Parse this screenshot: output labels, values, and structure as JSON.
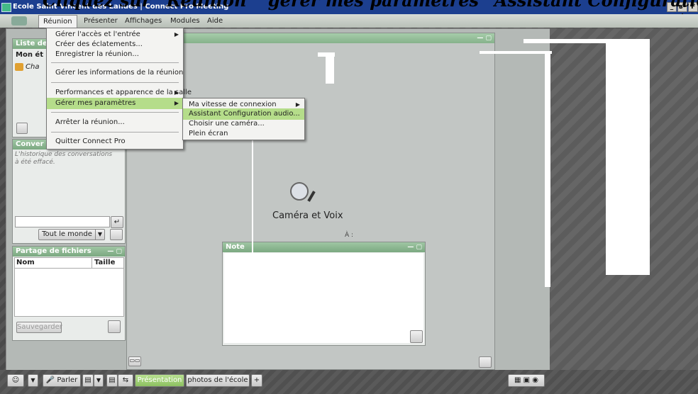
{
  "window": {
    "title": "Ecole Saint Vincent des Landes | Connect Pro Meeting",
    "controls": [
      "_",
      "в–¡",
      "Г—"
    ]
  },
  "caption": "Cliquez sur “Réunion” ‘gérer mes paramètres’ ‘Assistant Configuration",
  "menubar": {
    "items": [
      "Réunion",
      "Présenter",
      "Affichages",
      "Modules",
      "Aide"
    ]
  },
  "reunion_menu": {
    "items": [
      "Gérer l'accès et l'entrée",
      "Créer des éclatements...",
      "Enregistrer la réunion...",
      "Gérer les informations de la réunion",
      "Performances et apparence de la salle",
      "Gérer mes paramètres",
      "Arrêter la réunion...",
      "Quitter Connect Pro"
    ]
  },
  "parametres_menu": {
    "items": [
      "Ma vitesse de connexion",
      "Assistant Configuration audio...",
      "Choisir une caméra...",
      "Plein écran"
    ]
  },
  "attendees": {
    "title": "Liste de",
    "row_label": "Mon ét",
    "user": "Cha"
  },
  "chat": {
    "title": "Conver",
    "history_text": "L'historique des conversations à été effacé.",
    "recipient": "Tout le monde"
  },
  "files": {
    "title": "Partage de fichiers",
    "col_name": "Nom",
    "col_size": "Taille",
    "save_label": "Sauvegarder"
  },
  "camera": {
    "label": "Caméra et Voix",
    "to_label": "À :"
  },
  "note": {
    "title": "Note"
  },
  "bottombar": {
    "speak": "Parler",
    "tab_presentation": "Présentation",
    "tab_photos": "photos de l'école",
    "add": "+"
  }
}
